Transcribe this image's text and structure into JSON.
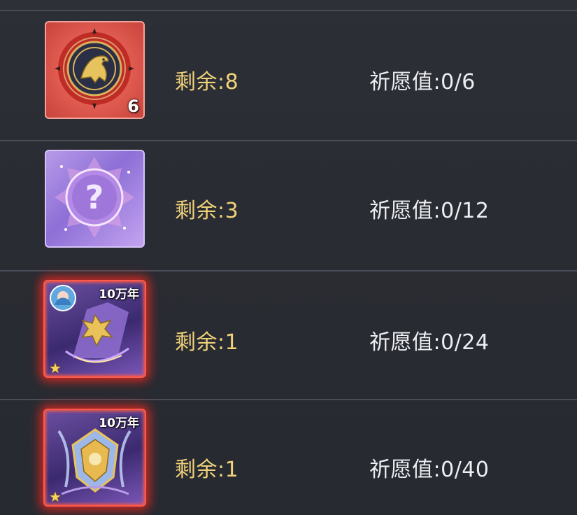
{
  "rows": [
    {
      "item_icon": "raven-emblem-icon",
      "count_badge": "6",
      "remaining": "剩余:8",
      "wish_value": "祈愿值:0/6"
    },
    {
      "item_icon": "mystery-question-icon",
      "remaining": "剩余:3",
      "wish_value": "祈愿值:0/12"
    },
    {
      "item_icon": "soul-bone-armor-icon",
      "age_badge": "10万年",
      "star": "★",
      "remaining": "剩余:1",
      "wish_value": "祈愿值:0/24"
    },
    {
      "item_icon": "soul-bone-helm-icon",
      "age_badge": "10万年",
      "star": "★",
      "remaining": "剩余:1",
      "wish_value": "祈愿值:0/40"
    }
  ],
  "colors": {
    "background": "#2a2c33",
    "divider": "#4a4d58",
    "remaining_text": "#f0d27a",
    "wish_text": "#eceef2",
    "rare_glow": "#ff3a2a"
  }
}
